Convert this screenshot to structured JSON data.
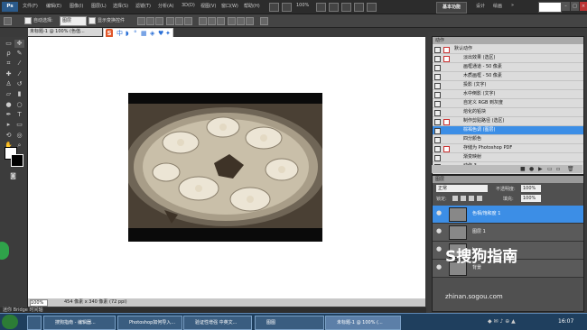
{
  "menubar": {
    "logo": "Ps",
    "items": [
      "文件(F)",
      "编辑(E)",
      "图像(I)",
      "图层(L)",
      "选择(S)",
      "滤镜(T)",
      "分析(A)",
      "3D(D)",
      "视图(V)",
      "窗口(W)",
      "帮助(H)"
    ],
    "zoom": "100%",
    "workspace_active": "基本功能",
    "workspace_links": [
      "设计",
      "绘画"
    ],
    "window_buttons": [
      "–",
      "□",
      "×"
    ]
  },
  "options": {
    "auto_select_label": "自动选择:",
    "auto_select_value": "图层",
    "show_transform_label": "显示变换控件"
  },
  "document": {
    "tab_title": "未标题-1 @ 100% (色值...",
    "zoom_value": "100%",
    "status_info": "454 像素 x 340 像素 (72 ppi)"
  },
  "bottom_strip": "迷你 Bridge  时间轴",
  "actions": {
    "tab": "动作",
    "rows": [
      {
        "label": "默认动作",
        "dialog": true
      },
      {
        "label": "淡出效果 (选区)",
        "dialog": true
      },
      {
        "label": "画框通道 - 50 像素",
        "dialog": false
      },
      {
        "label": "木质画框 - 50 像素",
        "dialog": false
      },
      {
        "label": "投影 (文字)",
        "dialog": false
      },
      {
        "label": "水中倒影 (文字)",
        "dialog": false
      },
      {
        "label": "自定义 RGB 到灰度",
        "dialog": false
      },
      {
        "label": "熔化的铅块",
        "dialog": false
      },
      {
        "label": "制作剪贴路径 (选区)",
        "dialog": true
      },
      {
        "label": "棕褐色调 (图层)",
        "dialog": false,
        "selected": true
      },
      {
        "label": "四分颜色",
        "dialog": false
      },
      {
        "label": "存储为 Photoshop PDF",
        "dialog": true
      },
      {
        "label": "渐变映射",
        "dialog": false
      },
      {
        "label": "动作 3",
        "dialog": false
      }
    ]
  },
  "layers": {
    "tab": "图层",
    "blend_mode": "正常",
    "opacity_label": "不透明度:",
    "opacity": "100%",
    "lock_label": "锁定:",
    "fill_label": "填充:",
    "fill": "100%",
    "items": [
      {
        "name": "色相/饱和度 1",
        "selected": true
      },
      {
        "name": "图层 1",
        "selected": false
      },
      {
        "name": "bmg",
        "selected": false
      },
      {
        "name": "背景",
        "selected": false
      }
    ]
  },
  "taskbar": {
    "tasks": [
      {
        "label": "搜狗指南 - 编辑器...",
        "active": false
      },
      {
        "label": "Photoshop如何导入...",
        "active": false
      },
      {
        "label": "验证性增强 中英文...",
        "active": false
      },
      {
        "label": "图图",
        "active": false
      },
      {
        "label": "未标题-1 @ 100% (...",
        "active": true
      }
    ],
    "clock": "16:07"
  },
  "watermark": {
    "brand": "S搜狗指南",
    "url": "zhinan.sogou.com"
  },
  "colors": {
    "selection_blue": "#3c8ee6",
    "panel_gray": "#3b3b3b"
  }
}
